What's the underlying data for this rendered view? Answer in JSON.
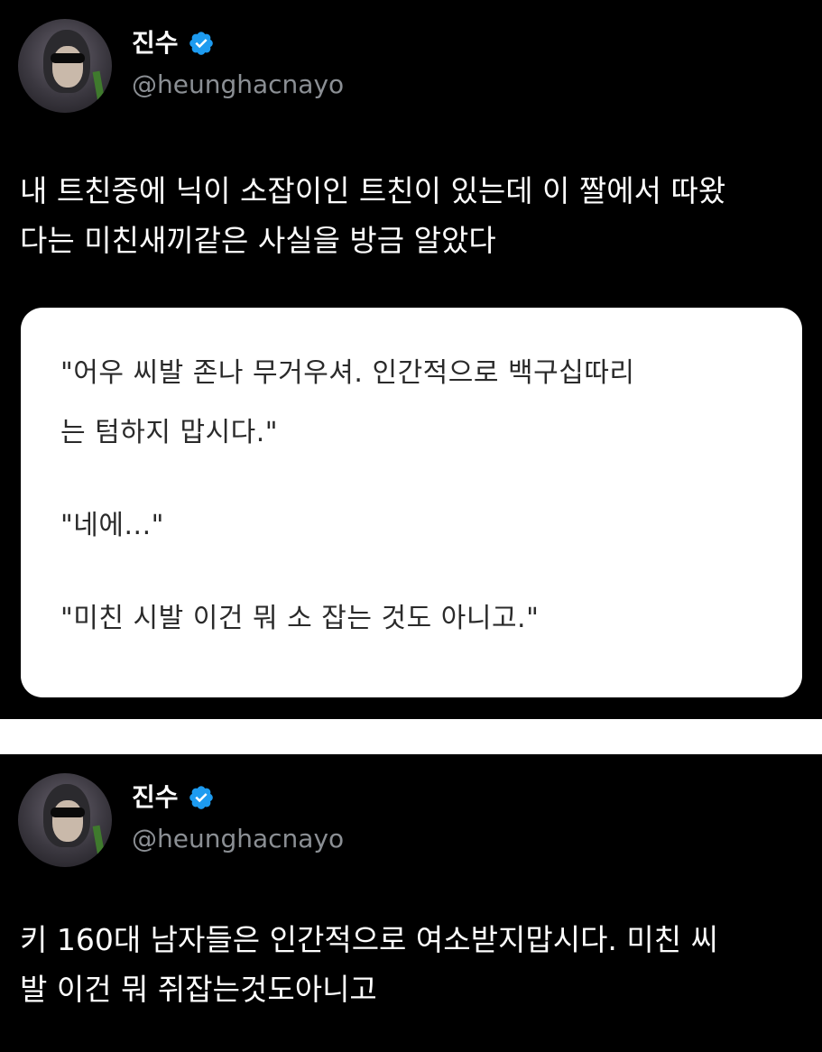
{
  "tweets": [
    {
      "author": {
        "name": "진수",
        "handle": "@heunghacnayo",
        "verified": true
      },
      "text": "내 트친중에 닉이 소잡이인 트친이 있는데 이 짤에서 따왔\n다는 미친새끼같은 사실을 방금 알았다",
      "quote_image": {
        "lines": [
          "\"어우 씨발 존나 무거우셔. 인간적으로 백구십따리",
          "는 텀하지 맙시다.\"",
          "\"네에...\"",
          "\"미친 시발 이건 뭐 소 잡는 것도 아니고.\""
        ]
      }
    },
    {
      "author": {
        "name": "진수",
        "handle": "@heunghacnayo",
        "verified": true
      },
      "text": "키 160대 남자들은 인간적으로 여소받지맙시다. 미친 씨\n발 이건 뭐 쥐잡는것도아니고"
    }
  ],
  "colors": {
    "background": "#000000",
    "separator": "#ffffff",
    "text": "#ffffff",
    "handle": "#8b8f94",
    "verified_badge": "#1d9bf0",
    "quote_card": "#ffffff",
    "quote_text": "#2a2a2a"
  },
  "icons": [
    "avatar",
    "verified-badge-icon"
  ]
}
